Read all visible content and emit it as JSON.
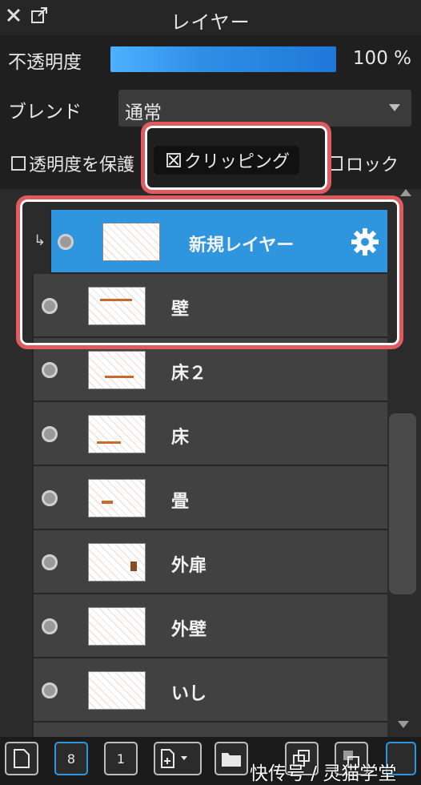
{
  "panel": {
    "title": "レイヤー"
  },
  "opacity": {
    "label": "不透明度",
    "value": "100 %",
    "level": 1.0
  },
  "blend": {
    "label": "ブレンド",
    "value": "通常"
  },
  "options": {
    "preserve_label": "透明度を保護",
    "clipping_label": "クリッピング",
    "lock_label": "ロック"
  },
  "layers": [
    {
      "name": "新規レイヤー",
      "selected": true,
      "clipped": true
    },
    {
      "name": "壁",
      "selected": false,
      "clipped": false
    },
    {
      "name": "床２",
      "selected": false,
      "clipped": false
    },
    {
      "name": "床",
      "selected": false,
      "clipped": false
    },
    {
      "name": "畳",
      "selected": false,
      "clipped": false
    },
    {
      "name": "外扉",
      "selected": false,
      "clipped": false
    },
    {
      "name": "外壁",
      "selected": false,
      "clipped": false
    },
    {
      "name": "いし",
      "selected": false,
      "clipped": false
    }
  ],
  "toolbar": {
    "b8": "8",
    "b1": "1"
  },
  "watermark": "快传号 / 灵猫学堂",
  "colors": {
    "accent": "#2f95df",
    "highlight": "#e05a60",
    "slider": "#2e8fe6"
  }
}
